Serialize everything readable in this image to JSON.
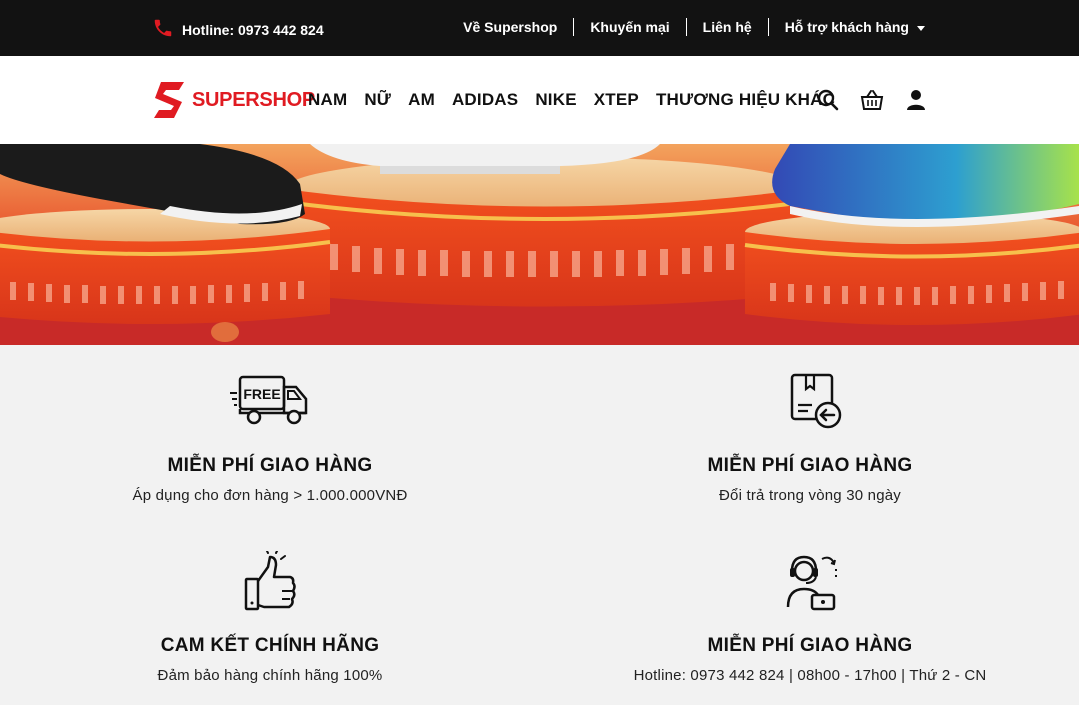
{
  "topbar": {
    "hotline": "Hotline: 0973 442 824",
    "links": [
      "Về Supershop",
      "Khuyến mại",
      "Liên hệ",
      "Hỗ trợ khách hàng"
    ]
  },
  "header": {
    "logo_text": "SUPERSHOP",
    "nav": [
      "NAM",
      "NỮ",
      "AM",
      "ADIDAS",
      "NIKE",
      "XTEP",
      "THƯƠNG HIỆU KHÁC"
    ]
  },
  "features": [
    {
      "title": "MIỄN PHÍ GIAO HÀNG",
      "desc": "Áp dụng cho đơn hàng > 1.000.000VNĐ",
      "icon": "free-delivery-truck-icon"
    },
    {
      "title": "MIỄN PHÍ GIAO HÀNG",
      "desc": "Đổi trả trong vòng 30 ngày",
      "icon": "return-package-icon"
    },
    {
      "title": "CAM KẾT CHÍNH HÃNG",
      "desc": "Đảm bảo hàng chính hãng 100%",
      "icon": "thumbs-up-icon"
    },
    {
      "title": "MIỄN PHÍ GIAO HÀNG",
      "desc": "Hotline: 0973 442 824 | 08h00 - 17h00 | Thứ 2 - CN",
      "icon": "support-agent-icon"
    }
  ],
  "colors": {
    "brand": "#e01b22",
    "topbar": "#121212",
    "features_bg": "#f2f2f2"
  }
}
